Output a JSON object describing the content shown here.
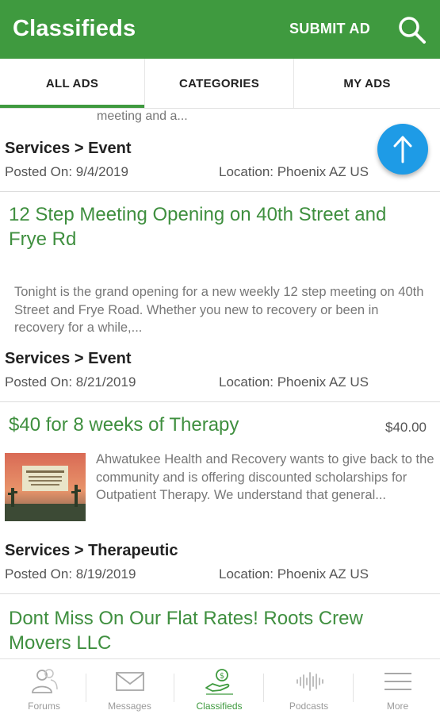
{
  "header": {
    "title": "Classifieds",
    "submit_label": "SUBMIT AD",
    "search_icon": "search-icon",
    "color": "#3f9a3f"
  },
  "tabs": [
    {
      "label": "ALL ADS",
      "active": true
    },
    {
      "label": "CATEGORIES",
      "active": false
    },
    {
      "label": "MY ADS",
      "active": false
    }
  ],
  "partial_listing": {
    "snippet": "meeting and a...",
    "category": "Services > Event",
    "posted": "Posted On: 9/4/2019",
    "location": "Location: Phoenix AZ US"
  },
  "listings": [
    {
      "title": "12 Step Meeting Opening on 40th Street and Frye Rd",
      "description": "Tonight is the grand opening for a new weekly 12 step meeting on 40th Street and Frye Road.  Whether you new to recovery or been in recovery for a while,...",
      "category": "Services > Event",
      "posted": "Posted On: 8/21/2019",
      "location": "Location: Phoenix AZ US"
    },
    {
      "title": "$40 for 8 weeks of Therapy",
      "price": "$40.00",
      "description": "Ahwatukee Health and Recovery wants to give back to the community and is offering discounted scholarships for Outpatient Therapy. We understand that general...",
      "category": "Services > Therapeutic",
      "posted": "Posted On: 8/19/2019",
      "location": "Location: Phoenix AZ US"
    },
    {
      "title": "Dont Miss On Our Flat Rates! Roots Crew Movers LLC"
    }
  ],
  "scroll_top_icon": "arrow-up-icon",
  "bottom_nav": [
    {
      "label": "Forums",
      "icon": "people-icon",
      "active": false
    },
    {
      "label": "Messages",
      "icon": "envelope-icon",
      "active": false
    },
    {
      "label": "Classifieds",
      "icon": "hand-dollar-icon",
      "active": true
    },
    {
      "label": "Podcasts",
      "icon": "audio-wave-icon",
      "active": false
    },
    {
      "label": "More",
      "icon": "menu-icon",
      "active": false
    }
  ],
  "colors": {
    "brand_green": "#3f9a3f",
    "title_green": "#3f8f3f",
    "fab_blue": "#1e9be6"
  }
}
